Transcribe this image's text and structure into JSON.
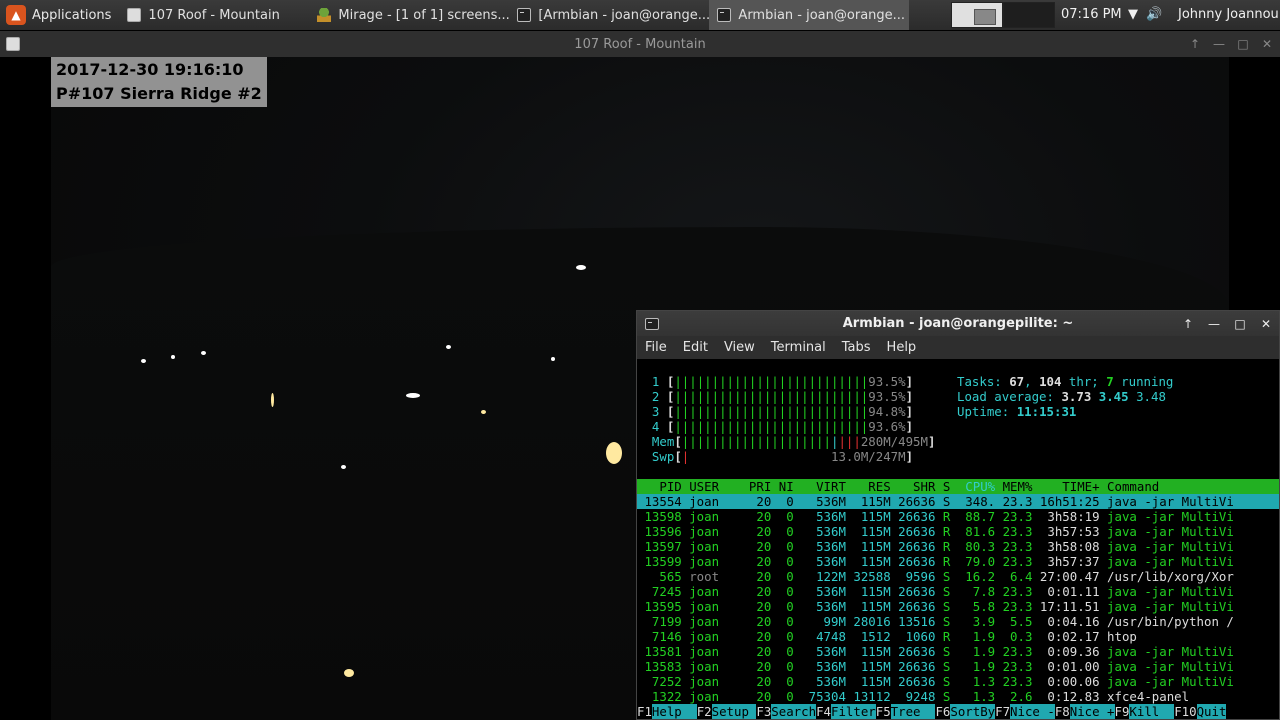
{
  "panel": {
    "applications_label": "Applications",
    "tasks": [
      {
        "label": "107 Roof - Mountain",
        "icon": "image-viewer-icon",
        "active": false
      },
      {
        "label": "Mirage - [1 of 1] screens...",
        "icon": "mirage-icon",
        "active": false
      },
      {
        "label": "[Armbian - joan@orange...",
        "icon": "terminal-icon",
        "active": false
      },
      {
        "label": "Armbian - joan@orange...",
        "icon": "terminal-icon",
        "active": true
      }
    ],
    "clock": "07:16 PM",
    "user": "Johnny Joannou"
  },
  "main_window": {
    "title": "107 Roof - Mountain",
    "overlay_line1": "2017-12-30 19:16:10",
    "overlay_line2": "P#107 Sierra Ridge #2"
  },
  "terminal": {
    "title": "Armbian - joan@orangepilite: ~",
    "menu": [
      "File",
      "Edit",
      "View",
      "Terminal",
      "Tabs",
      "Help"
    ],
    "cpus": [
      {
        "id": "1",
        "pct": "93.5%"
      },
      {
        "id": "2",
        "pct": "93.5%"
      },
      {
        "id": "3",
        "pct": "94.8%"
      },
      {
        "id": "4",
        "pct": "93.6%"
      }
    ],
    "mem": "280M/495M",
    "swp": "13.0M/247M",
    "tasks_count": "67",
    "threads": "104",
    "running": "7",
    "load1": "3.73",
    "load5": "3.45",
    "load15": "3.48",
    "uptime": "11:15:31",
    "headers": [
      "PID",
      "USER",
      "PRI",
      "NI",
      "VIRT",
      "RES",
      "SHR",
      "S",
      "CPU%",
      "MEM%",
      "TIME+",
      "Command"
    ],
    "processes": [
      [
        "13554",
        "joan",
        "20",
        "0",
        "536M",
        "115M",
        "26636",
        "S",
        "348.",
        "23.3",
        "16h51:25",
        "java -jar MultiVi"
      ],
      [
        "13598",
        "joan",
        "20",
        "0",
        "536M",
        "115M",
        "26636",
        "R",
        "88.7",
        "23.3",
        "3h58:19",
        "java -jar MultiVi"
      ],
      [
        "13596",
        "joan",
        "20",
        "0",
        "536M",
        "115M",
        "26636",
        "R",
        "81.6",
        "23.3",
        "3h57:53",
        "java -jar MultiVi"
      ],
      [
        "13597",
        "joan",
        "20",
        "0",
        "536M",
        "115M",
        "26636",
        "R",
        "80.3",
        "23.3",
        "3h58:08",
        "java -jar MultiVi"
      ],
      [
        "13599",
        "joan",
        "20",
        "0",
        "536M",
        "115M",
        "26636",
        "R",
        "79.0",
        "23.3",
        "3h57:37",
        "java -jar MultiVi"
      ],
      [
        "565",
        "root",
        "20",
        "0",
        "122M",
        "32588",
        "9596",
        "S",
        "16.2",
        "6.4",
        "27:00.47",
        "/usr/lib/xorg/Xor"
      ],
      [
        "7245",
        "joan",
        "20",
        "0",
        "536M",
        "115M",
        "26636",
        "S",
        "7.8",
        "23.3",
        "0:01.11",
        "java -jar MultiVi"
      ],
      [
        "13595",
        "joan",
        "20",
        "0",
        "536M",
        "115M",
        "26636",
        "S",
        "5.8",
        "23.3",
        "17:11.51",
        "java -jar MultiVi"
      ],
      [
        "7199",
        "joan",
        "20",
        "0",
        "99M",
        "28016",
        "13516",
        "S",
        "3.9",
        "5.5",
        "0:04.16",
        "/usr/bin/python /"
      ],
      [
        "7146",
        "joan",
        "20",
        "0",
        "4748",
        "1512",
        "1060",
        "R",
        "1.9",
        "0.3",
        "0:02.17",
        "htop"
      ],
      [
        "13581",
        "joan",
        "20",
        "0",
        "536M",
        "115M",
        "26636",
        "S",
        "1.9",
        "23.3",
        "0:09.36",
        "java -jar MultiVi"
      ],
      [
        "13583",
        "joan",
        "20",
        "0",
        "536M",
        "115M",
        "26636",
        "S",
        "1.9",
        "23.3",
        "0:01.00",
        "java -jar MultiVi"
      ],
      [
        "7252",
        "joan",
        "20",
        "0",
        "536M",
        "115M",
        "26636",
        "S",
        "1.3",
        "23.3",
        "0:00.06",
        "java -jar MultiVi"
      ],
      [
        "1322",
        "joan",
        "20",
        "0",
        "75304",
        "13112",
        "9248",
        "S",
        "1.3",
        "2.6",
        "0:12.83",
        "xfce4-panel"
      ]
    ],
    "fkeys": [
      {
        "key": "F1",
        "label": "Help  "
      },
      {
        "key": "F2",
        "label": "Setup "
      },
      {
        "key": "F3",
        "label": "Search"
      },
      {
        "key": "F4",
        "label": "Filter"
      },
      {
        "key": "F5",
        "label": "Tree  "
      },
      {
        "key": "F6",
        "label": "SortBy"
      },
      {
        "key": "F7",
        "label": "Nice -"
      },
      {
        "key": "F8",
        "label": "Nice +"
      },
      {
        "key": "F9",
        "label": "Kill  "
      },
      {
        "key": "F10",
        "label": "Quit"
      }
    ]
  }
}
